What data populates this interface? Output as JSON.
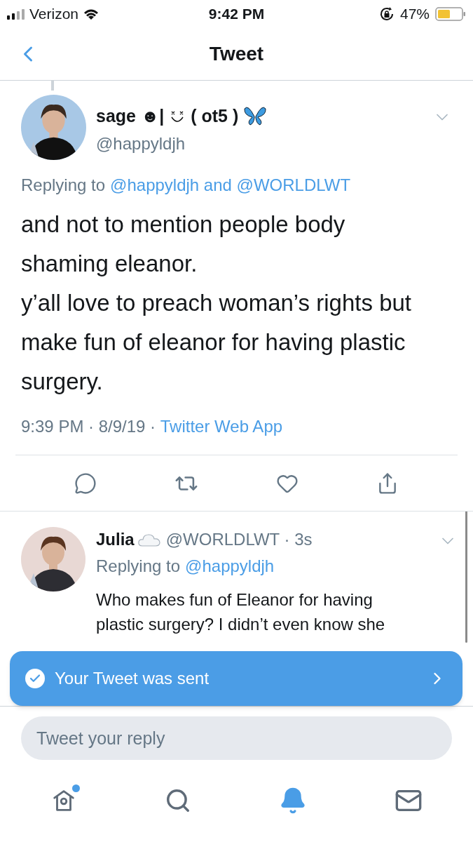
{
  "status_bar": {
    "carrier": "Verizon",
    "time": "9:42 PM",
    "battery": "47%"
  },
  "nav": {
    "title": "Tweet"
  },
  "tweet": {
    "name": "sage ☻|",
    "name_suffix": "( ot5 )",
    "handle": "@happyldjh",
    "reply_prefix": "Replying to",
    "reply_to": "@happyldjh and @WORLDLWT",
    "text": "and not to mention people body shaming eleanor.\ny’all love to preach woman’s rights but make fun of eleanor for having plastic surgery.",
    "timestamp": "9:39 PM · 8/9/19 · ",
    "source": "Twitter Web App"
  },
  "reply": {
    "name": "Julia",
    "handle": "@WORLDLWT · 3s",
    "reply_prefix": "Replying to",
    "reply_to": "@happyldjh",
    "text": "Who makes fun of Eleanor for having plastic surgery? I didn’t even know she"
  },
  "toast": {
    "text": "Your Tweet was sent"
  },
  "composer": {
    "placeholder": "Tweet your reply"
  },
  "tabs": [
    {
      "kind": "home",
      "selected": false,
      "badge": true
    },
    {
      "kind": "search",
      "selected": false,
      "badge": false
    },
    {
      "kind": "notifications",
      "selected": true,
      "badge": false
    },
    {
      "kind": "messages",
      "selected": false,
      "badge": false
    }
  ]
}
